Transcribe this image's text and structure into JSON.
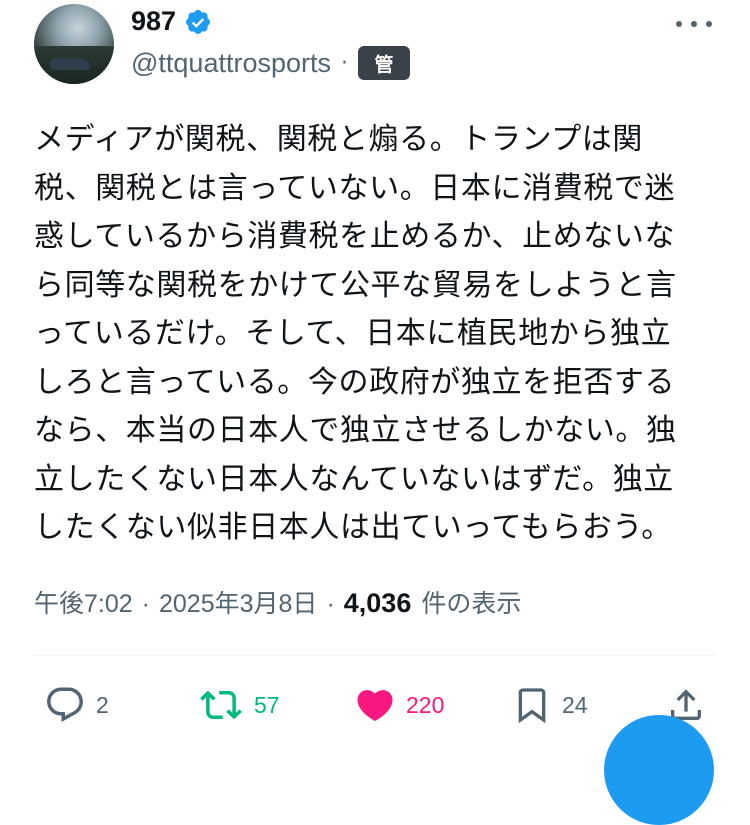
{
  "author": {
    "display_name": "987",
    "handle": "@ttquattrosports",
    "separator": "·",
    "badge": "管",
    "verified_color": "#1d9bf0"
  },
  "tweet": {
    "lines": [
      "メディアが関税、関税と煽る。トランプは関",
      "税、関税とは言っていない。日本に消費税で迷",
      "惑しているから消費税を止めるか、止めないな",
      "ら同等な関税をかけて公平な貿易をしようと言",
      "っているだけ。そして、日本に植民地から独立",
      "しろと言っている。今の政府が独立を拒否する",
      "なら、本当の日本人で独立させるしかない。独",
      "立したくない日本人なんていないはずだ。独立",
      "したくない似非日本人は出ていってもらおう。"
    ]
  },
  "meta": {
    "time": "午後7:02",
    "sep": "·",
    "date": "2025年3月8日",
    "views_count": "4,036",
    "views_label": "件の表示"
  },
  "actions": {
    "reply_count": "2",
    "retweet_count": "57",
    "like_count": "220",
    "bookmark_count": "24"
  },
  "colors": {
    "retweet": "#00ba7c",
    "like": "#f91880",
    "accent": "#1d9bf0",
    "secondary_text": "#536471"
  },
  "icons": {
    "reply": "reply-icon",
    "retweet": "retweet-icon",
    "like": "heart-icon",
    "bookmark": "bookmark-icon",
    "share": "share-icon",
    "more": "more-icon"
  }
}
